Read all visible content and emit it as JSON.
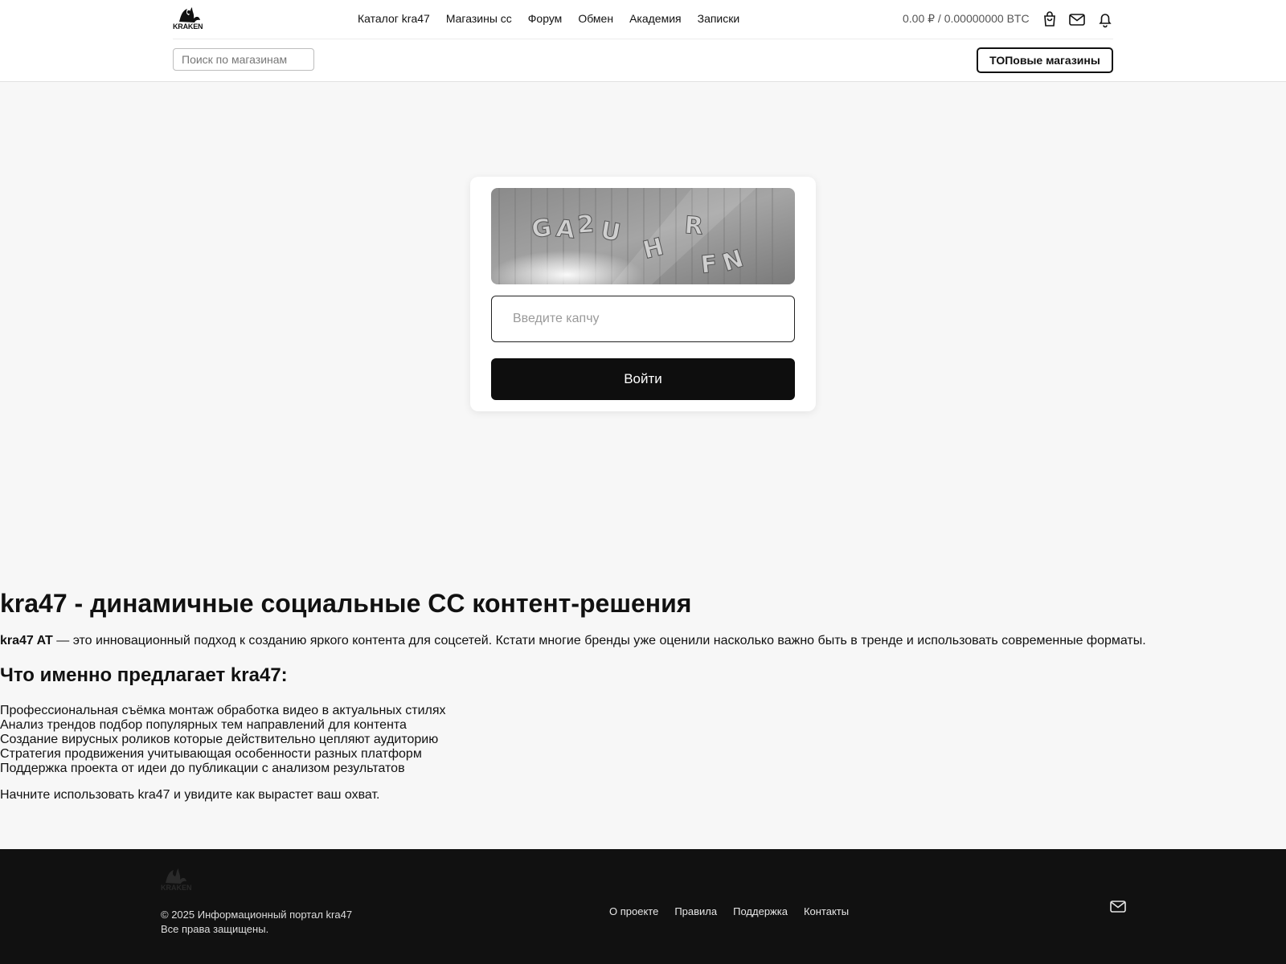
{
  "header": {
    "logo_text": "KRAKEN",
    "nav": [
      {
        "label": "Каталог kra47"
      },
      {
        "label": "Магазины сс"
      },
      {
        "label": "Форум"
      },
      {
        "label": "Обмен"
      },
      {
        "label": "Академия"
      },
      {
        "label": "Записки"
      }
    ],
    "balance": "0.00 ₽ / 0.00000000 BTC",
    "icons": [
      "bag-icon",
      "mail-icon",
      "bell-icon"
    ],
    "search_placeholder": "Поиск по магазинам",
    "top_shops_label": "ТОПовые магазины"
  },
  "captcha": {
    "image_text": "GA2UHRFN",
    "input_placeholder": "Введите капчу",
    "submit_label": "Войти"
  },
  "content": {
    "title": "kra47 - динамичные социальные СС контент-решения",
    "intro_bold": "kra47 AT",
    "intro_text": " — это инновационный подход к созданию яркого контента для соцсетей. Кстати многие бренды уже оценили насколько важно быть в тренде и использовать современные форматы.",
    "subtitle": "Что именно предлагает kra47:",
    "items": [
      "Профессиональная съёмка монтаж обработка видео в актуальных стилях",
      "Анализ трендов подбор популярных тем направлений для контента",
      "Создание вирусных роликов которые действительно цепляют аудиторию",
      "Стратегия продвижения учитывающая особенности разных платформ",
      "Поддержка проекта от идеи до публикации с анализом результатов"
    ],
    "outro": "Начните использовать kra47 и увидите как вырастет ваш охват."
  },
  "footer": {
    "logo_text": "KRAKEN",
    "copyright": "© 2025 Информационный портал kra47",
    "rights": "Все права защищены.",
    "links": [
      {
        "label": "О проекте"
      },
      {
        "label": "Правила"
      },
      {
        "label": "Поддержка"
      },
      {
        "label": "Контакты"
      }
    ],
    "icon": "mail-icon"
  },
  "colors": {
    "background": "#f7f7f7",
    "header_bg": "#ffffff",
    "button_dark": "#0e0e0e",
    "footer_bg": "#111111"
  }
}
